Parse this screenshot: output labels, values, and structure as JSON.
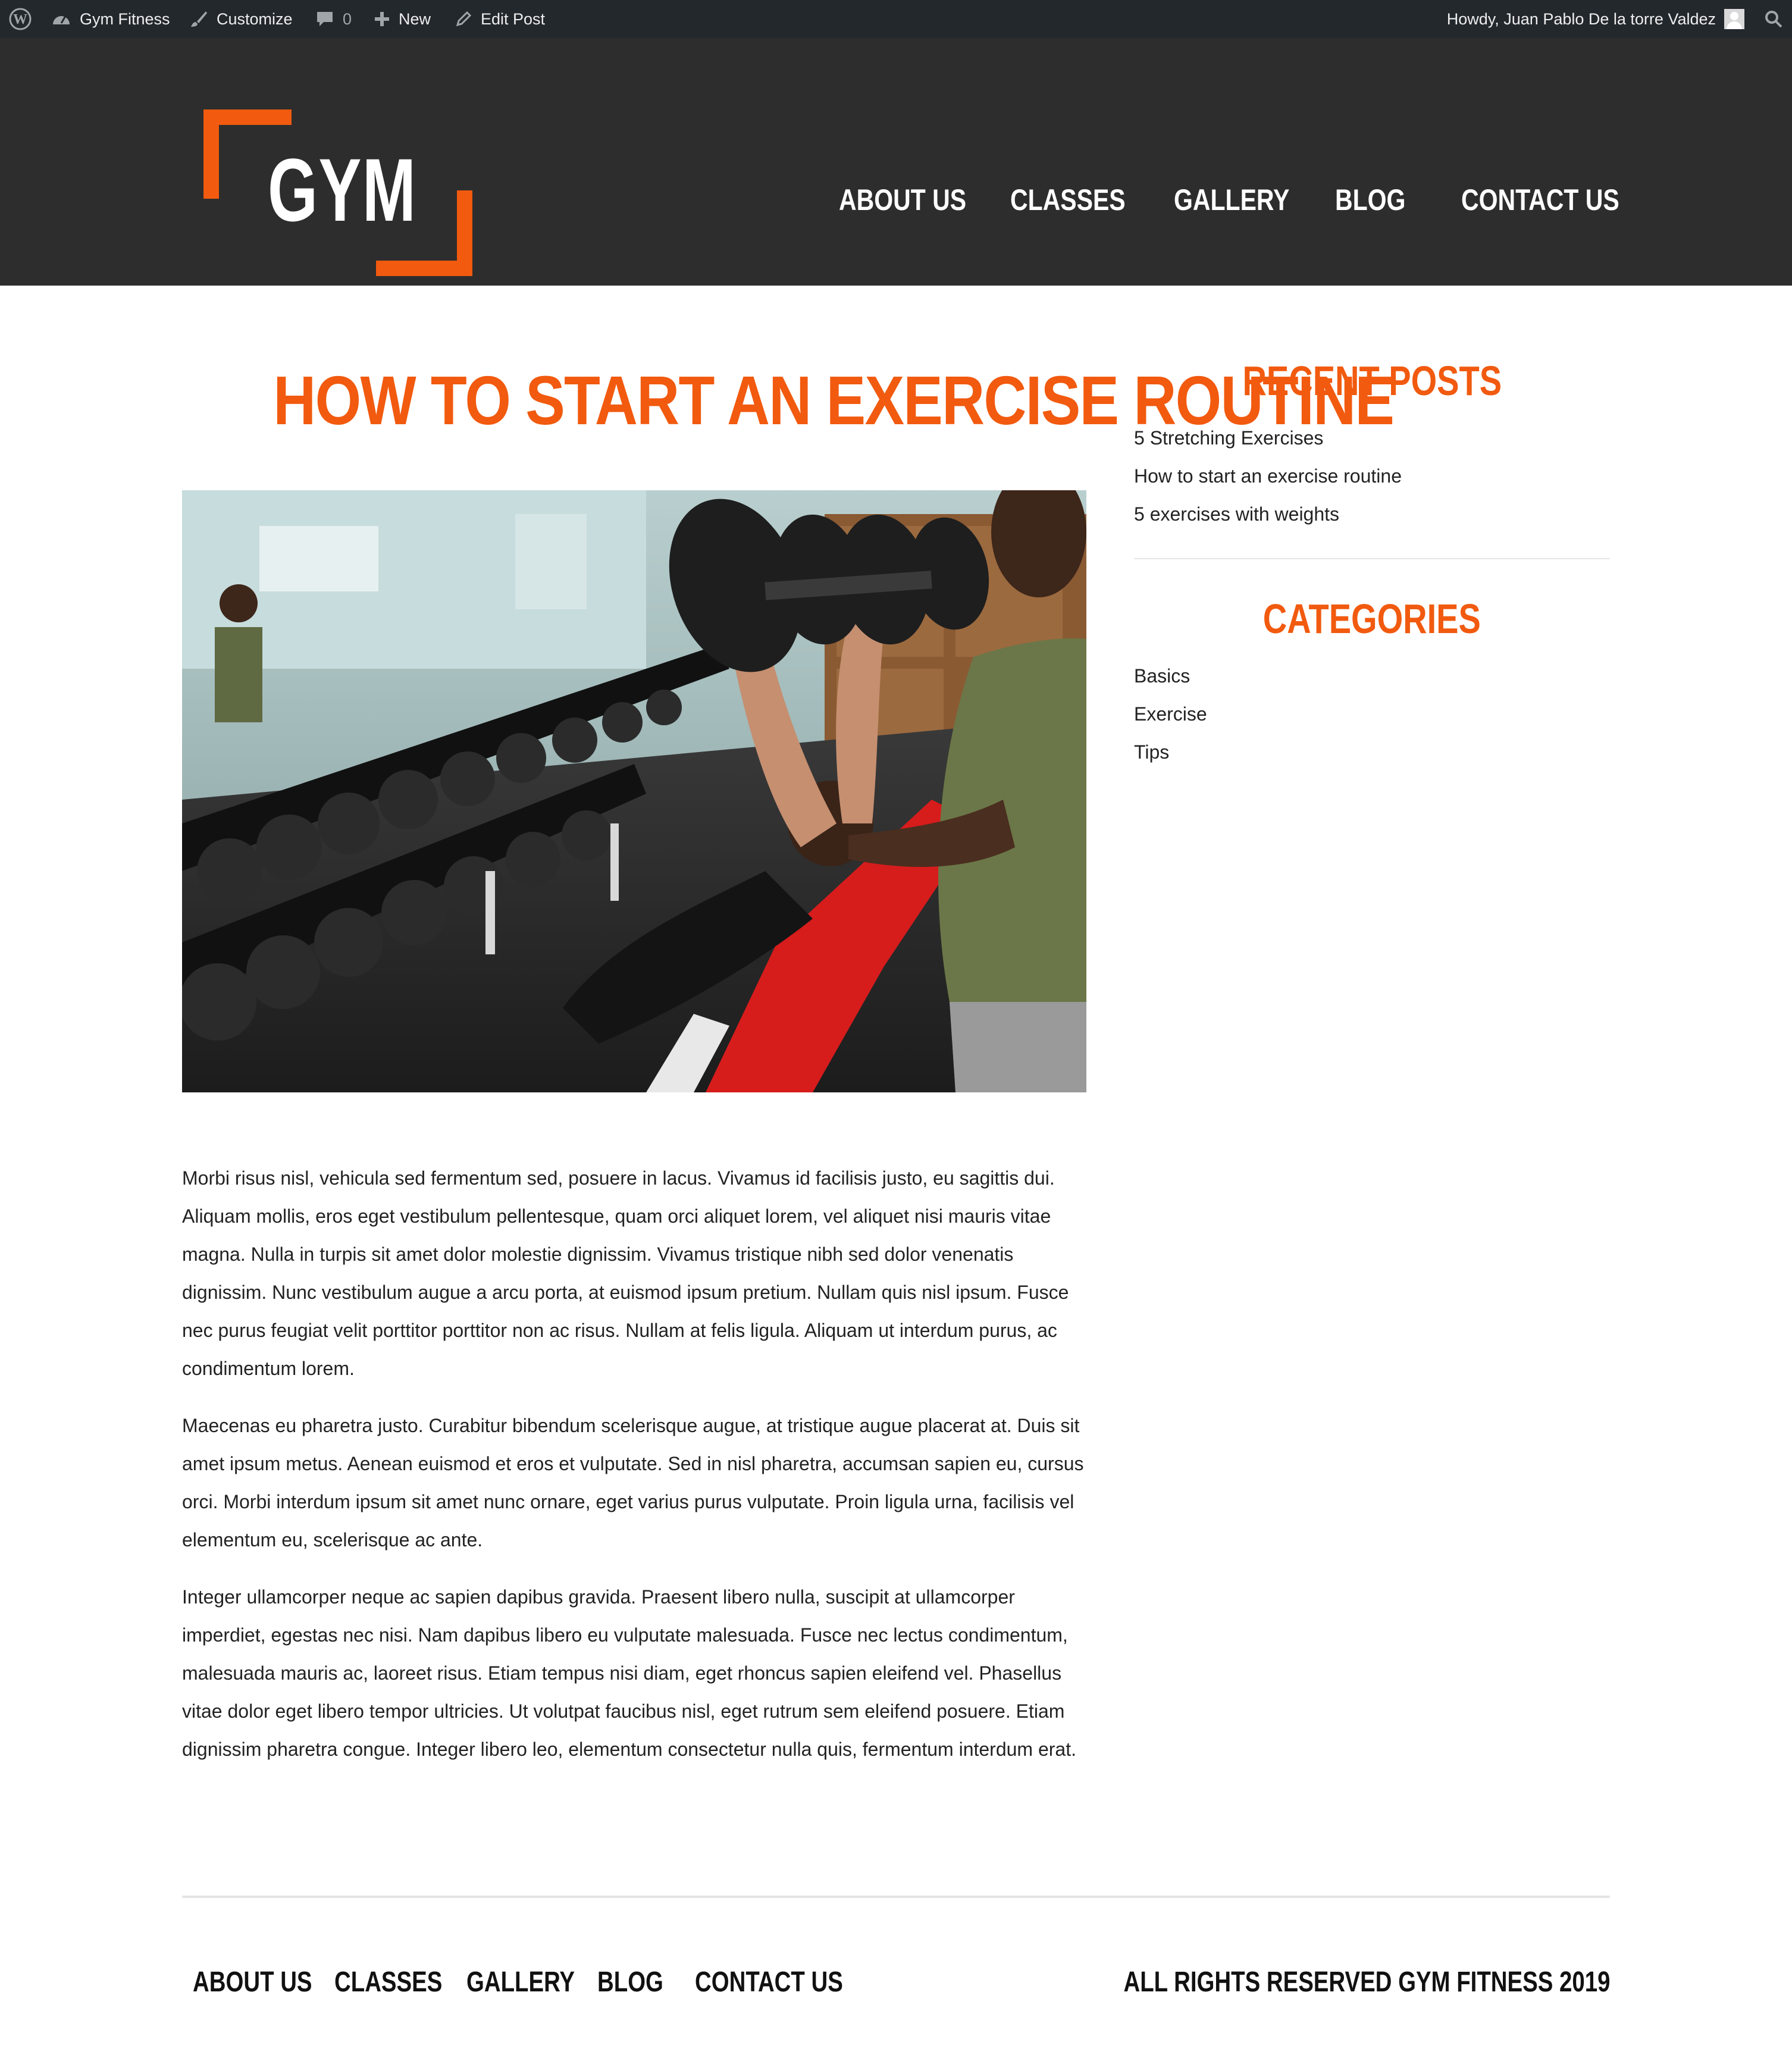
{
  "admin_bar": {
    "wp_icon": "wordpress-icon",
    "site_name": "Gym Fitness",
    "site_icon": "dashboard-icon",
    "customize": "Customize",
    "customize_icon": "paintbrush-icon",
    "comments_count": "0",
    "comments_icon": "comment-bubble-icon",
    "new": "New",
    "new_icon": "plus-icon",
    "edit_post": "Edit Post",
    "edit_icon": "pencil-icon",
    "howdy": "Howdy, Juan Pablo De la torre Valdez",
    "search_icon": "search-icon"
  },
  "header": {
    "logo_text": "GYM",
    "nav": [
      "About Us",
      "Classes",
      "Gallery",
      "Blog",
      "Contact Us"
    ]
  },
  "post": {
    "title": "How to start an exercise routine",
    "paragraphs": [
      "Morbi risus nisl, vehicula sed fermentum sed, posuere in lacus. Vivamus id facilisis justo, eu sagittis dui. Aliquam mollis, eros eget vestibulum pellentesque, quam orci aliquet lorem, vel aliquet nisi mauris vitae magna. Nulla in turpis sit amet dolor molestie dignissim. Vivamus tristique nibh sed dolor venenatis dignissim. Nunc vestibulum augue a arcu porta, at euismod ipsum pretium. Nullam quis nisl ipsum. Fusce nec purus feugiat velit porttitor porttitor non ac risus. Nullam at felis ligula. Aliquam ut interdum purus, ac condimentum lorem.",
      "Maecenas eu pharetra justo. Curabitur bibendum scelerisque augue, at tristique augue placerat at. Duis sit amet ipsum metus. Aenean euismod et eros et vulputate. Sed in nisl pharetra, accumsan sapien eu, cursus orci. Morbi interdum ipsum sit amet nunc ornare, eget varius purus vulputate. Proin ligula urna, facilisis vel elementum eu, scelerisque ac ante.",
      "Integer ullamcorper neque ac sapien dapibus gravida. Praesent libero nulla, suscipit at ullamcorper imperdiet, egestas nec nisi. Nam dapibus libero eu vulputate malesuada. Fusce nec lectus condimentum, malesuada mauris ac, laoreet risus. Etiam tempus nisi diam, eget rhoncus sapien eleifend vel. Phasellus vitae dolor eget libero tempor ultricies. Ut volutpat faucibus nisl, eget rutrum sem eleifend posuere. Etiam dignissim pharetra congue. Integer libero leo, elementum consectetur nulla quis, fermentum interdum erat."
    ]
  },
  "sidebar": {
    "recent_posts_title": "Recent Posts",
    "recent_posts": [
      "5 Stretching Exercises",
      "How to start an exercise routine",
      "5 exercises with weights"
    ],
    "categories_title": "Categories",
    "categories": [
      "Basics",
      "Exercise",
      "Tips"
    ]
  },
  "footer": {
    "nav": [
      "About Us",
      "Classes",
      "Gallery",
      "Blog",
      "Contact Us"
    ],
    "copyright": "All Rights Reserved Gym Fitness 2019"
  },
  "colors": {
    "accent": "#f15a0f",
    "header_bg": "#2d2d2d",
    "admin_bar_bg": "#23282d"
  }
}
